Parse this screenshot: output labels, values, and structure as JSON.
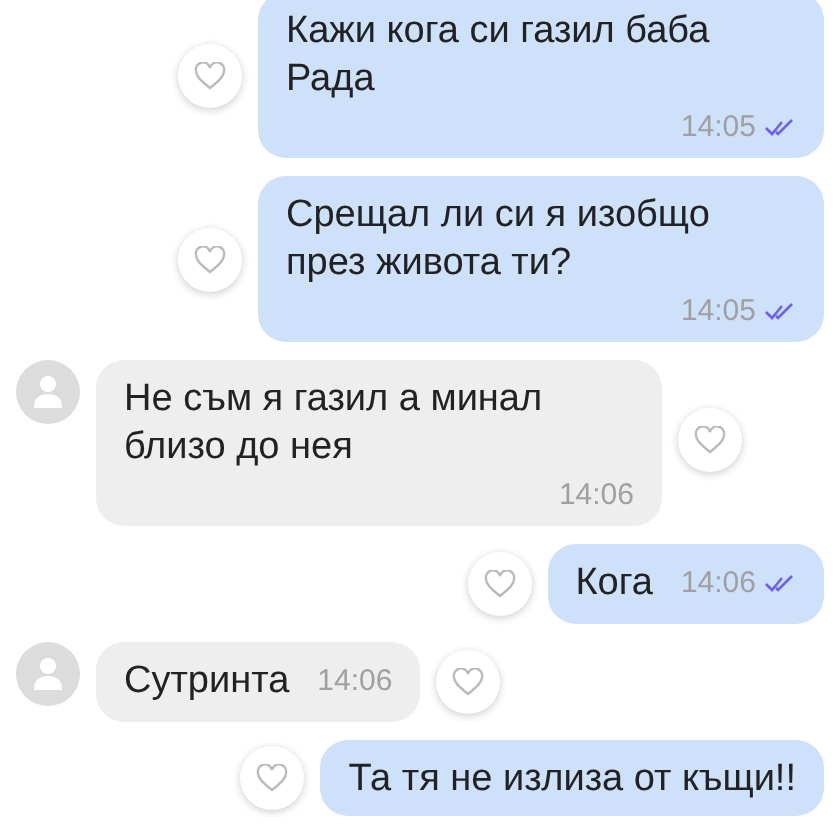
{
  "messages": [
    {
      "kind": "outgoing",
      "text": "Кажи кога си газил баба Рада",
      "time": "14:05",
      "time_inline": false,
      "read": true
    },
    {
      "kind": "outgoing",
      "text": "Срещал ли си я изобщо през живота ти?",
      "time": "14:05",
      "time_inline": false,
      "read": true
    },
    {
      "kind": "incoming",
      "text": "Не съм я газил а минал близо до нея",
      "time": "14:06",
      "time_inline": false
    },
    {
      "kind": "outgoing",
      "text": "Кога",
      "time": "14:06",
      "time_inline": true,
      "read": true
    },
    {
      "kind": "incoming",
      "text": "Сутринта",
      "time": "14:06",
      "time_inline": true
    },
    {
      "kind": "outgoing",
      "text": "Та тя не излиза от къщи!!",
      "time_inline": false
    }
  ]
}
